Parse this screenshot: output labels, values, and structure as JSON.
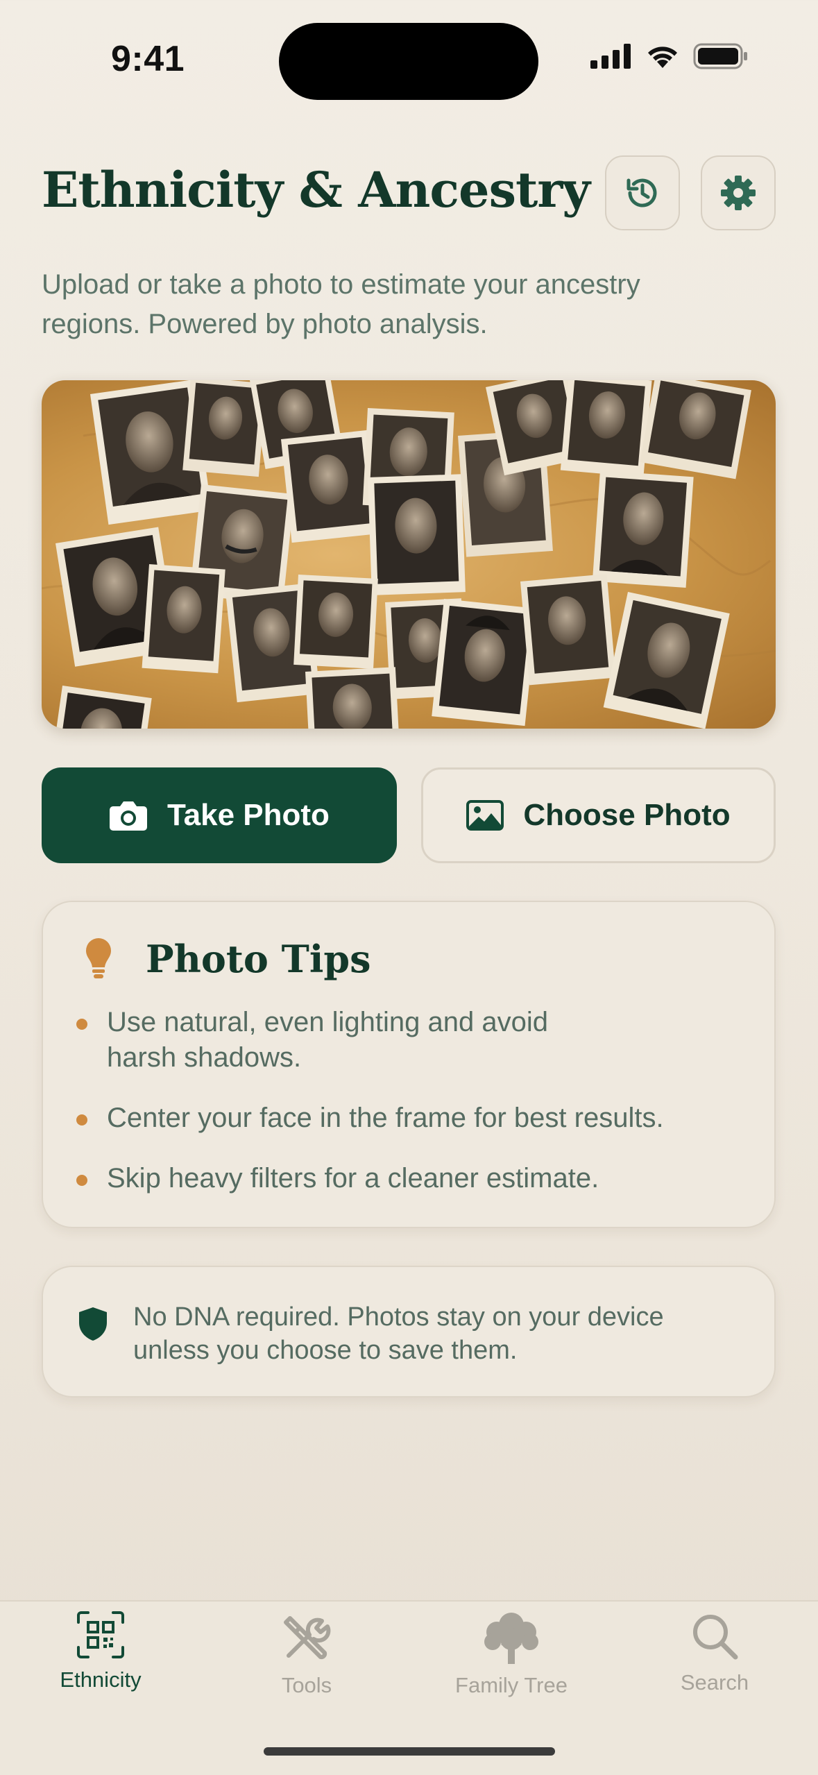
{
  "status_bar": {
    "time": "9:41"
  },
  "header": {
    "title": "Ethnicity & Ancestry"
  },
  "subtitle": "Upload or take a photo to estimate your ancestry regions. Powered by photo analysis.",
  "actions": {
    "take_photo": "Take Photo",
    "choose_photo": "Choose Photo"
  },
  "tips": {
    "title": "Photo Tips",
    "items": [
      "Use natural, even lighting and avoid harsh shadows.",
      "Center your face in the frame for best results.",
      "Skip heavy filters for a cleaner estimate."
    ]
  },
  "privacy_note": "No DNA required. Photos stay on your device unless you choose to save them.",
  "tabbar": {
    "items": [
      {
        "label": "Ethnicity",
        "icon": "qr-scan-icon",
        "active": true
      },
      {
        "label": "Tools",
        "icon": "tools-icon",
        "active": false
      },
      {
        "label": "Family Tree",
        "icon": "tree-icon",
        "active": false
      },
      {
        "label": "Search",
        "icon": "search-icon",
        "active": false
      }
    ]
  },
  "colors": {
    "primary": "#124a36",
    "accent": "#cf8a3f",
    "background": "#f2ede4",
    "muted_text": "#5c7469"
  }
}
